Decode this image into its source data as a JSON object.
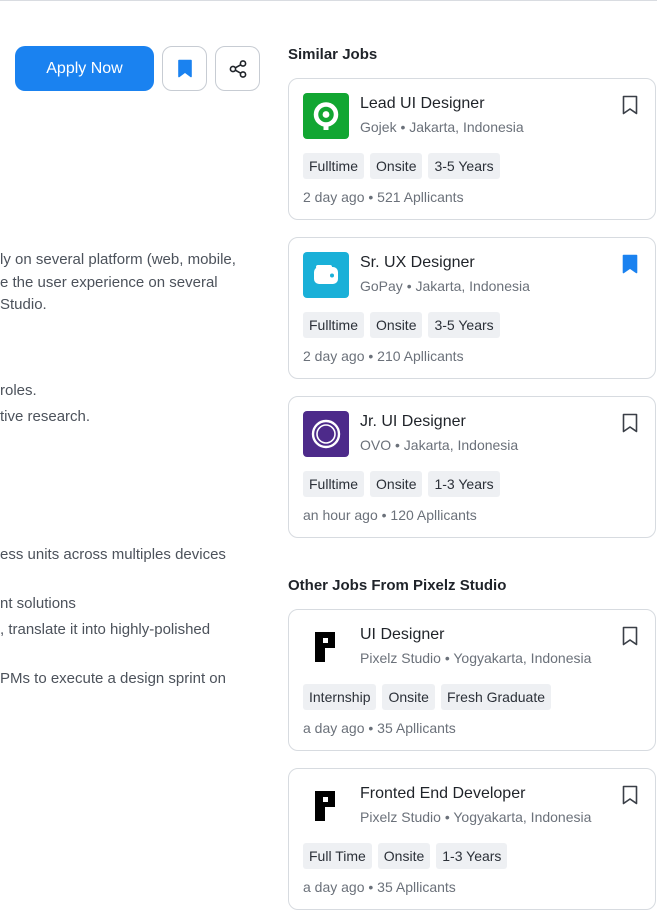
{
  "actions": {
    "apply_label": "Apply Now"
  },
  "description": {
    "lines": [
      "ly on several platform (web, mobile,",
      "e the user experience on several",
      "Studio.",
      "roles.",
      "tive research.",
      "ess units across multiples devices",
      "nt solutions",
      ", translate it into highly-polished",
      "PMs to execute a design sprint on"
    ]
  },
  "similar": {
    "title": "Similar Jobs",
    "jobs": [
      {
        "title": "Lead UI Designer",
        "company": "Gojek",
        "location": "Jakarta, Indonesia",
        "subtitle": "Gojek • Jakarta, Indonesia",
        "tags": [
          "Fulltime",
          "Onsite",
          "3-5 Years"
        ],
        "meta": "2 day ago • 521 Apllicants",
        "logo_color": "#12a632",
        "logo_icon": "gojek-logo",
        "bookmarked": false
      },
      {
        "title": "Sr. UX Designer",
        "company": "GoPay",
        "location": "Jakarta, Indonesia",
        "subtitle": "GoPay • Jakarta, Indonesia",
        "tags": [
          "Fulltime",
          "Onsite",
          "3-5 Years"
        ],
        "meta": "2 day ago • 210 Apllicants",
        "logo_color": "#1ab0d8",
        "logo_icon": "gopay-logo",
        "bookmarked": true
      },
      {
        "title": "Jr. UI Designer",
        "company": "OVO",
        "location": "Jakarta, Indonesia",
        "subtitle": "OVO • Jakarta, Indonesia",
        "tags": [
          "Fulltime",
          "Onsite",
          "1-3 Years"
        ],
        "meta": "an hour ago • 120 Apllicants",
        "logo_color": "#4d2a8a",
        "logo_icon": "ovo-logo",
        "bookmarked": false
      }
    ]
  },
  "other": {
    "title": "Other Jobs From Pixelz Studio",
    "jobs": [
      {
        "title": "UI Designer",
        "company": "Pixelz Studio",
        "location": "Yogyakarta, Indonesia",
        "subtitle": "Pixelz Studio • Yogyakarta, Indonesia",
        "tags": [
          "Internship",
          "Onsite",
          "Fresh Graduate"
        ],
        "meta": "a day ago • 35 Apllicants",
        "logo_color": "#000000",
        "logo_icon": "pixelz-logo",
        "bookmarked": false
      },
      {
        "title": "Fronted End Developer",
        "company": "Pixelz Studio",
        "location": "Yogyakarta, Indonesia",
        "subtitle": "Pixelz Studio • Yogyakarta, Indonesia",
        "tags": [
          "Full Time",
          "Onsite",
          "1-3 Years"
        ],
        "meta": "a day ago • 35 Apllicants",
        "logo_color": "#000000",
        "logo_icon": "pixelz-logo",
        "bookmarked": false
      }
    ]
  },
  "colors": {
    "primary": "#1a82f0",
    "bookmark_active": "#1a82f0",
    "tag_bg": "#eef0f3",
    "muted_text": "#6b717a"
  }
}
